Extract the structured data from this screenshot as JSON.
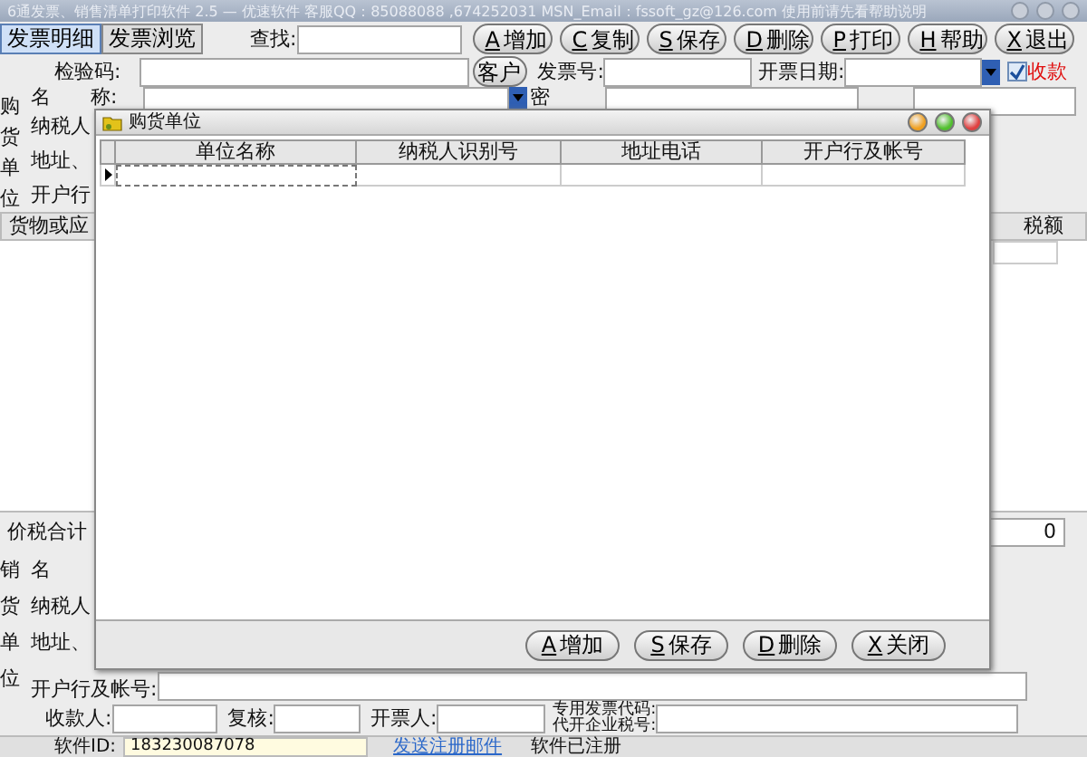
{
  "window": {
    "title": "6通发票、销售清单打印软件 2.5 — 优速软件 客服QQ：85088088 ,674252031  MSN_Email：fssoft_gz@126.com  使用前请先看帮助说明"
  },
  "tabs": [
    {
      "label": "发票明细",
      "selected": true
    },
    {
      "label": "发票浏览",
      "selected": false
    }
  ],
  "search": {
    "label": "查找:"
  },
  "toolbar_buttons": [
    {
      "key": "A",
      "label": "增加"
    },
    {
      "key": "C",
      "label": "复制"
    },
    {
      "key": "S",
      "label": "保存"
    },
    {
      "key": "D",
      "label": "删除"
    },
    {
      "key": "P",
      "label": "打印"
    },
    {
      "key": "H",
      "label": "帮助"
    },
    {
      "key": "X",
      "label": "退出"
    }
  ],
  "header": {
    "check_code_label": "检验码:",
    "customer_button": "客户",
    "invoice_no_label": "发票号:",
    "date_label": "开票日期:",
    "received": {
      "label": "收款",
      "checked": true
    }
  },
  "buyer": {
    "side_label": "购货单位",
    "name_label": "名　　称:",
    "password_label": "密",
    "rows": [
      "纳税人",
      "地址、",
      "开户行"
    ]
  },
  "items": {
    "first_column": "货物或应",
    "tax_column": "税额"
  },
  "total": {
    "label": "价税合计",
    "value": "0"
  },
  "seller": {
    "side_label": "销货单位",
    "rows": [
      "名",
      "纳税人",
      "地址、"
    ],
    "bank_label": "开户行及帐号:"
  },
  "signers": {
    "payee_label": "收款人:",
    "reviewer_label": "复核:",
    "drawer_label": "开票人:",
    "code_label": "专用发票代码:",
    "agent_label": "代开企业税号:"
  },
  "status_bar": {
    "id_label": "软件ID:",
    "id_value": "183230087078",
    "link": "发送注册邮件",
    "registered": "软件已注册"
  },
  "dialog": {
    "title": "购货单位",
    "columns": [
      "单位名称",
      "纳税人识别号",
      "地址电话",
      "开户行及帐号"
    ],
    "rows": [
      {
        "selected": true
      }
    ],
    "buttons": [
      {
        "key": "A",
        "label": "增加"
      },
      {
        "key": "S",
        "label": "保存"
      },
      {
        "key": "D",
        "label": "删除"
      },
      {
        "key": "X",
        "label": "关闭"
      }
    ]
  }
}
